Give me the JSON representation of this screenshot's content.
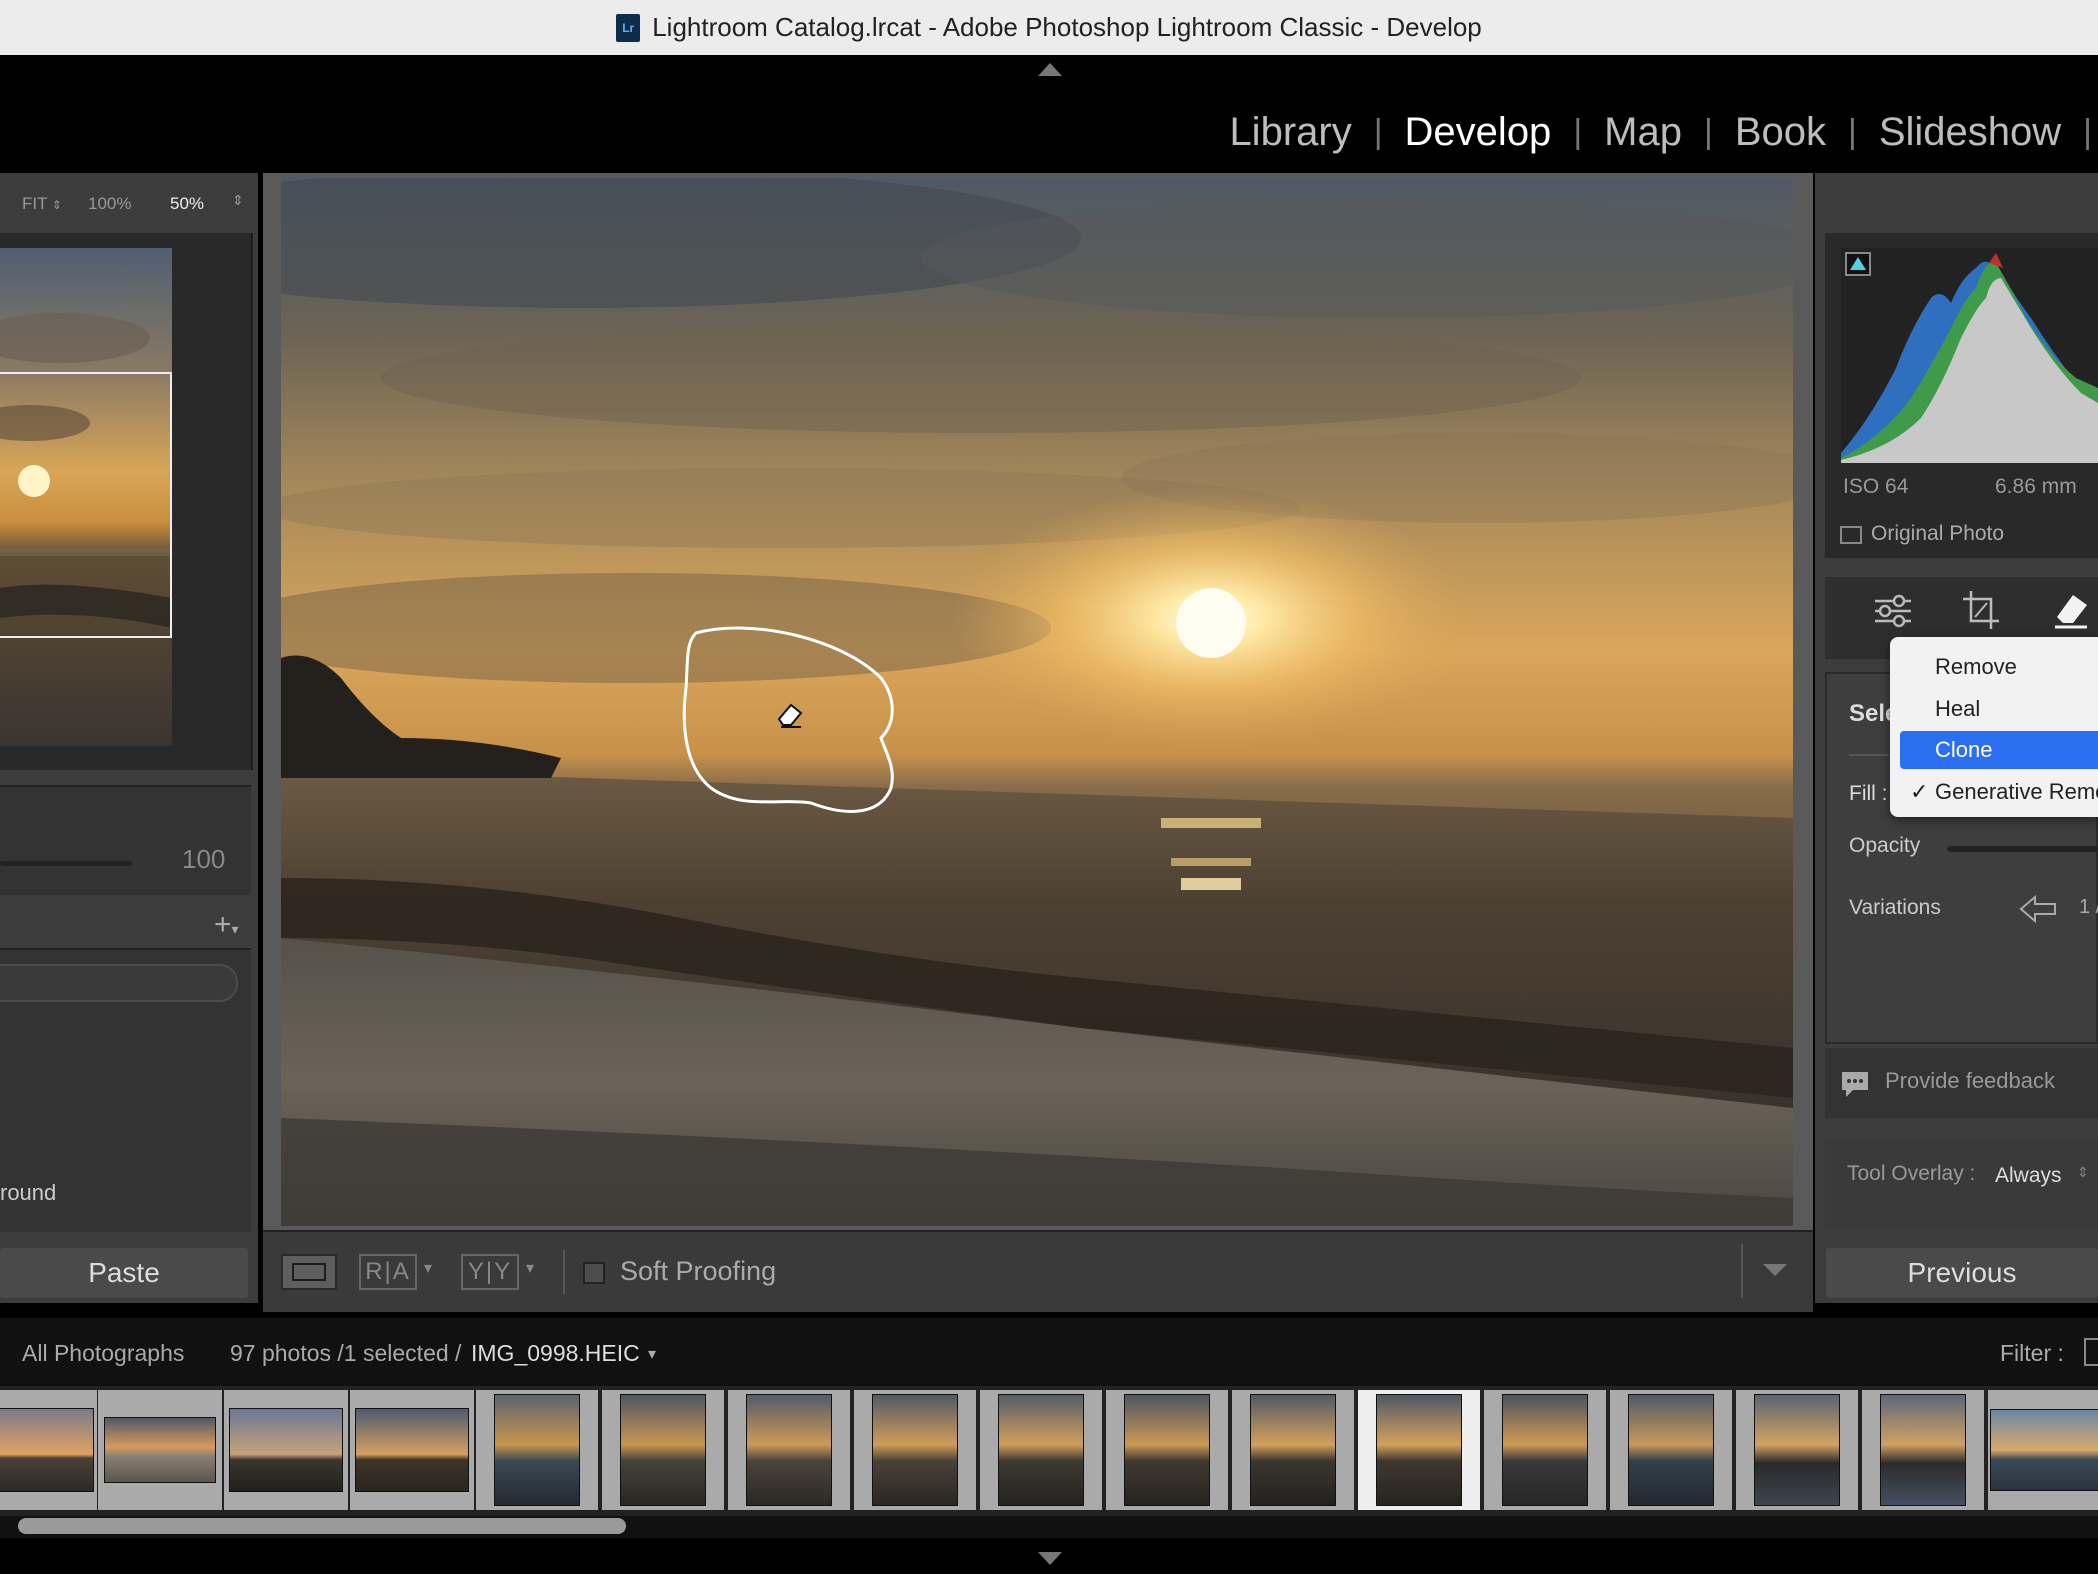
{
  "window": {
    "app_icon": "Lr",
    "title": "Lightroom Catalog.lrcat - Adobe Photoshop Lightroom Classic - Develop"
  },
  "modules": [
    {
      "label": "Library",
      "active": false
    },
    {
      "label": "Develop",
      "active": true
    },
    {
      "label": "Map",
      "active": false
    },
    {
      "label": "Book",
      "active": false
    },
    {
      "label": "Slideshow",
      "active": false
    }
  ],
  "navigator": {
    "fit": "FIT",
    "zoom_100": "100%",
    "zoom_50": "50%"
  },
  "left_panel": {
    "slider_value": "100",
    "partial_label": "round",
    "paste_label": "Paste"
  },
  "toolbar": {
    "ra_label": "R|A",
    "yy_label": "Y|Y",
    "soft_proofing": "Soft Proofing"
  },
  "histogram": {
    "iso": "ISO 64",
    "focal_length": "6.86 mm",
    "original_photo": "Original Photo"
  },
  "remove_panel": {
    "select_label": "Sele",
    "fill_label": "Fill :",
    "opacity_label": "Opacity",
    "variations_label": "Variations",
    "variations_count": "1 /"
  },
  "mode_menu": {
    "items": [
      {
        "label": "Remove",
        "selected": false,
        "checked": false
      },
      {
        "label": "Heal",
        "selected": false,
        "checked": false
      },
      {
        "label": "Clone",
        "selected": true,
        "checked": false
      },
      {
        "label": "Generative Remo",
        "selected": false,
        "checked": true
      }
    ]
  },
  "feedback": {
    "label": "Provide feedback"
  },
  "tool_overlay": {
    "label": "Tool Overlay :",
    "value": "Always"
  },
  "previous_label": "Previous",
  "filmstrip_bar": {
    "source": "All Photographs",
    "count": "97 photos /1 selected /",
    "filename": "IMG_0998.HEIC",
    "filter_label": "Filter :"
  },
  "colors": {
    "menu_highlight": "#2a6ff0",
    "panel_bg": "#3c3c3c",
    "histogram_blue": "#2f6fc0",
    "histogram_green": "#3f9a4a"
  }
}
